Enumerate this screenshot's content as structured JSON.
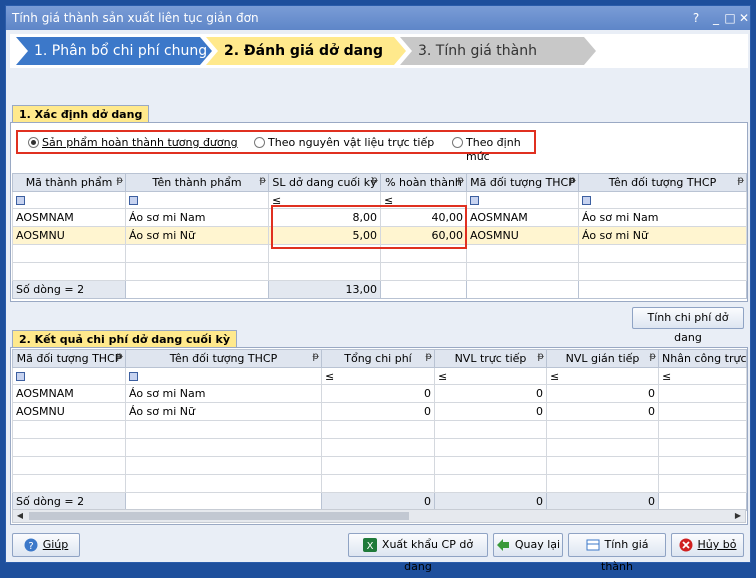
{
  "window": {
    "title": "Tính giá thành sản xuất liên tục giản đơn",
    "controls": [
      "?",
      "_",
      "□",
      "✕"
    ]
  },
  "wizard": {
    "steps": [
      "1. Phân bổ chi phí chung",
      "2. Đánh giá dở dang",
      "3. Tính giá thành"
    ]
  },
  "section1": {
    "title": "1. Xác định dở dang",
    "radios": [
      "Sản phẩm hoàn thành tương đương",
      "Theo nguyên vật liệu trực tiếp",
      "Theo định mức"
    ],
    "columns": [
      "Mã thành phẩm",
      "Tên thành phẩm",
      "SL dở dang cuối kỳ",
      "% hoàn thành",
      "Mã đối tượng THCP",
      "Tên đối tượng THCP"
    ],
    "filter_ops": [
      "≤",
      "≤"
    ],
    "rows": [
      [
        "AOSMNAM",
        "Áo sơ mi Nam",
        "8,00",
        "40,00",
        "AOSMNAM",
        "Áo sơ mi Nam"
      ],
      [
        "AOSMNU",
        "Áo sơ mi Nữ",
        "5,00",
        "60,00",
        "AOSMNU",
        "Áo sơ mi Nữ"
      ]
    ],
    "footer": {
      "count": "Số dòng = 2",
      "total_qty": "13,00"
    }
  },
  "calc_button": "Tính chi phí dở dang",
  "section2": {
    "title": "2. Kết quả chi phí dở dang cuối kỳ",
    "columns": [
      "Mã đối tượng THCP",
      "Tên đối tượng THCP",
      "Tổng chi phí",
      "NVL trực tiếp",
      "NVL gián tiếp",
      "Nhân công trực t"
    ],
    "filter_ops": [
      "≤",
      "≤",
      "≤",
      "≤"
    ],
    "rows": [
      [
        "AOSMNAM",
        "Áo sơ mi Nam",
        "0",
        "0",
        "0",
        ""
      ],
      [
        "AOSMNU",
        "Áo sơ mi Nữ",
        "0",
        "0",
        "0",
        ""
      ]
    ],
    "footer": {
      "count": "Số dòng = 2",
      "totals": [
        "0",
        "0",
        "0"
      ]
    }
  },
  "buttons": {
    "help": "Giúp",
    "export": "Xuất khẩu CP dở dang",
    "back": "Quay lại",
    "compute": "Tính giá thành",
    "cancel": "Hủy bỏ"
  },
  "colors": {
    "accent": "#3c78c9",
    "active_step": "#ffe98c",
    "highlight": "#e03020"
  }
}
